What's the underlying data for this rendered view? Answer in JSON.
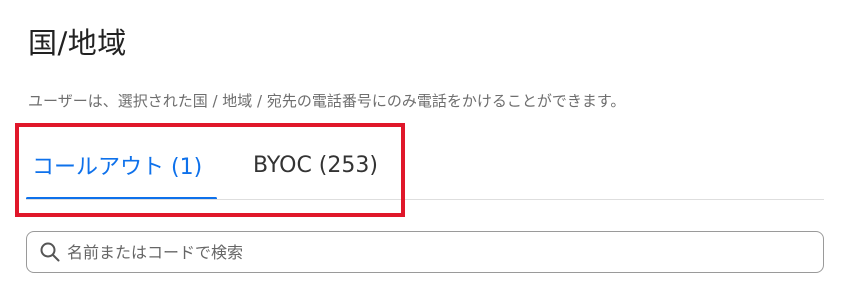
{
  "header": {
    "title": "国/地域",
    "description": "ユーザーは、選択された国 / 地域 / 宛先の電話番号にのみ電話をかけることができます。"
  },
  "tabs": [
    {
      "label": "コールアウト (1)",
      "active": true
    },
    {
      "label": "BYOC (253)",
      "active": false
    }
  ],
  "search": {
    "placeholder": "名前またはコードで検索",
    "value": "",
    "icon": "search-icon"
  },
  "colors": {
    "accent": "#0e71eb",
    "highlight_box": "#e0172a",
    "text": "#222222",
    "muted_text": "#6e6e6e"
  }
}
